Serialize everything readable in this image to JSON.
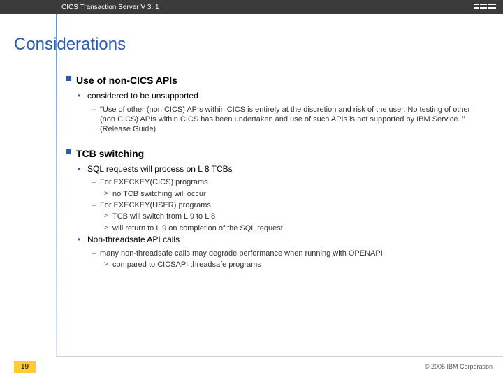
{
  "header": {
    "product": "CICS Transaction Server V 3. 1",
    "logo_alt": "IBM"
  },
  "title": "Considerations",
  "sections": [
    {
      "heading": "Use of non-CICS APIs",
      "items": [
        {
          "text": "considered to be unsupported",
          "sub": [
            {
              "text": "\"Use of other (non CICS) APIs within CICS is entirely at the discretion and risk of the user. No testing of other (non CICS) APIs within CICS has been undertaken and use of such APIs is not supported by IBM Service. \" (Release Guide)"
            }
          ]
        }
      ]
    },
    {
      "heading": "TCB switching",
      "items": [
        {
          "text": "SQL requests will process on L 8 TCBs",
          "sub": [
            {
              "text": "For EXECKEY(CICS) programs",
              "sub3": [
                "no TCB switching will occur"
              ]
            },
            {
              "text": "For EXECKEY(USER) programs",
              "sub3": [
                "TCB will switch from L 9 to L 8",
                "will return to L 9 on completion of the SQL request"
              ]
            }
          ]
        },
        {
          "text": "Non-threadsafe API calls",
          "sub": [
            {
              "text": "many non-threadsafe calls may degrade performance when running with OPENAPI",
              "sub3": [
                "compared to CICSAPI threadsafe programs"
              ]
            }
          ]
        }
      ]
    }
  ],
  "footer": {
    "page": "19",
    "copyright": "© 2005 IBM Corporation"
  }
}
